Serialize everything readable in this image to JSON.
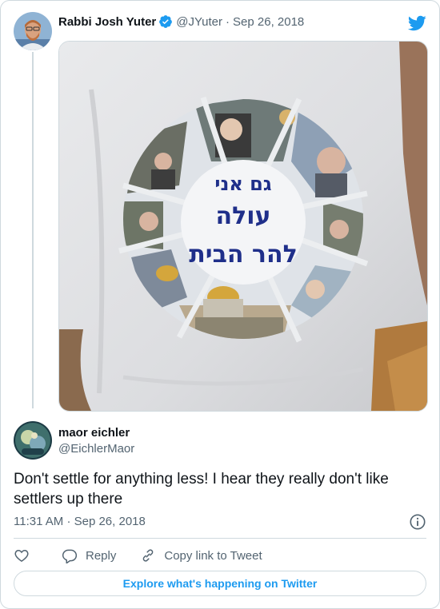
{
  "parent_tweet": {
    "author_name": "Rabbi Josh Yuter",
    "handle": "@JYuter",
    "separator": "·",
    "date": "Sep 26, 2018",
    "verified": true,
    "photo": {
      "shirt_text_line1": "גם אני",
      "shirt_text_line2": "עולה",
      "shirt_text_line3": "להר הבית"
    }
  },
  "reply_tweet": {
    "author_name": "maor eichler",
    "handle": "@EichlerMaor",
    "text": "Don't settle for anything less! I hear they really don't like settlers up there",
    "time": "11:31 AM",
    "separator": "·",
    "date": "Sep 26, 2018"
  },
  "actions": {
    "reply_label": "Reply",
    "copy_link_label": "Copy link to Tweet",
    "explore_label": "Explore what's happening on Twitter"
  },
  "icons": {
    "brand": "twitter-bird-icon",
    "verified": "verified-badge-icon",
    "like": "heart-icon",
    "reply": "speech-bubble-icon",
    "copy_link": "link-icon",
    "info": "info-icon"
  },
  "colors": {
    "accent": "#1d9bf0",
    "text_primary": "#0f1419",
    "text_secondary": "#536471",
    "border": "#cfd9de"
  }
}
